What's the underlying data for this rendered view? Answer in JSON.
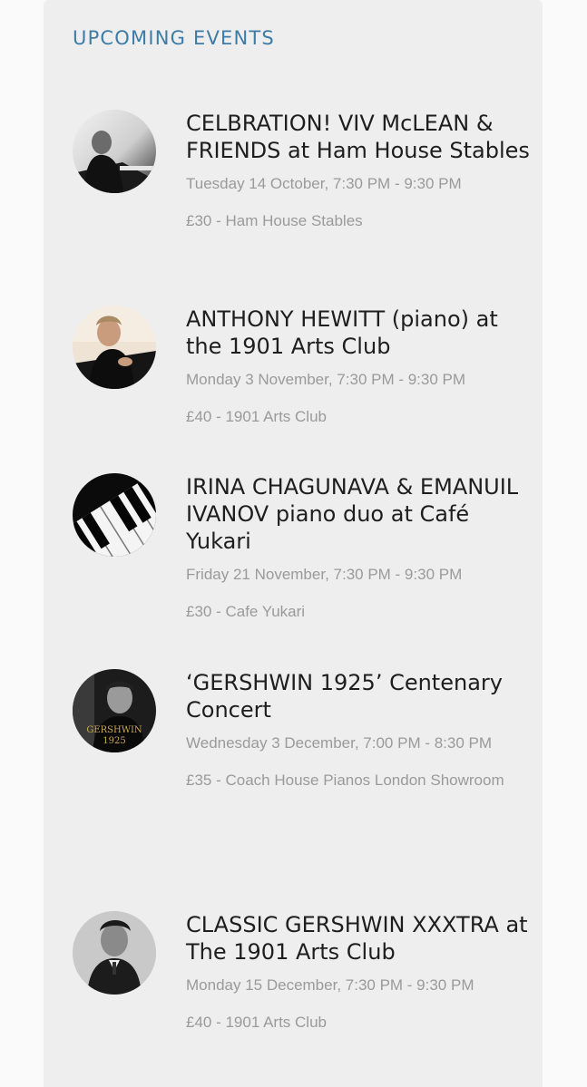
{
  "section": {
    "title": "UPCOMING EVENTS"
  },
  "events": [
    {
      "title": "CELBRATION! VIV McLEAN & FRIENDS at Ham House Stables",
      "datetime": "Tuesday 14 October, 7:30 PM - 9:30 PM",
      "price_venue": "£30 - Ham House Stables",
      "thumbnail": "pianist-photo-icon"
    },
    {
      "title": "ANTHONY HEWITT (piano) at the 1901 Arts Club",
      "datetime": "Monday 3 November, 7:30 PM - 9:30 PM",
      "price_venue": "£40 - 1901 Arts Club",
      "thumbnail": "pianist-photo-icon"
    },
    {
      "title": "IRINA CHAGUNAVA & EMANUIL IVANOV piano duo at Café Yukari",
      "datetime": "Friday 21 November, 7:30 PM - 9:30 PM",
      "price_venue": "£30 - Cafe Yukari",
      "thumbnail": "piano-keys-icon"
    },
    {
      "title": "‘GERSHWIN 1925’ Centenary Concert",
      "datetime": "Wednesday 3 December, 7:00 PM - 8:30 PM",
      "price_venue": "£35 - Coach House Pianos London Showroom",
      "thumbnail": "gershwin-1925-poster-icon",
      "thumbnail_text": "GERSHWIN 1925"
    },
    {
      "title": "CLASSIC GERSHWIN XXXTRA at The 1901 Arts Club",
      "datetime": "Monday 15 December, 7:30 PM - 9:30 PM",
      "price_venue": "£40 - 1901 Arts Club",
      "thumbnail": "gershwin-portrait-icon"
    }
  ],
  "colors": {
    "accent": "#3e7ca6",
    "title_text": "#1e1e1e",
    "meta_text": "#9a9a9a",
    "panel_bg": "#eeeeee",
    "page_bg": "#fafafa"
  }
}
